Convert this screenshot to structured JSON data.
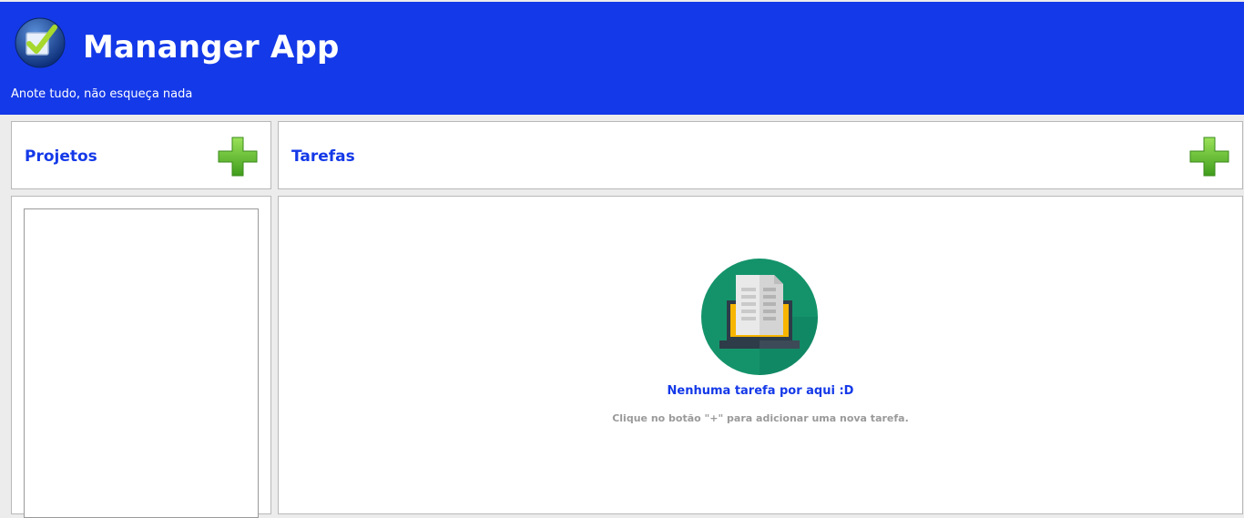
{
  "app": {
    "title": "Mananger App",
    "subtitle": "Anote tudo, não esqueça nada"
  },
  "colors": {
    "header_blue": "#1439e8",
    "plus_green": "#5cc234",
    "illustration_teal": "#14936a"
  },
  "icons": {
    "logo": "checkbox-check-icon",
    "add": "plus-icon",
    "empty": "laptop-document-icon"
  },
  "projects": {
    "title": "Projetos",
    "items": []
  },
  "tasks": {
    "title": "Tarefas",
    "empty_title": "Nenhuma tarefa por aqui :D",
    "empty_hint": "Clique no botão \"+\" para adicionar uma nova tarefa."
  }
}
